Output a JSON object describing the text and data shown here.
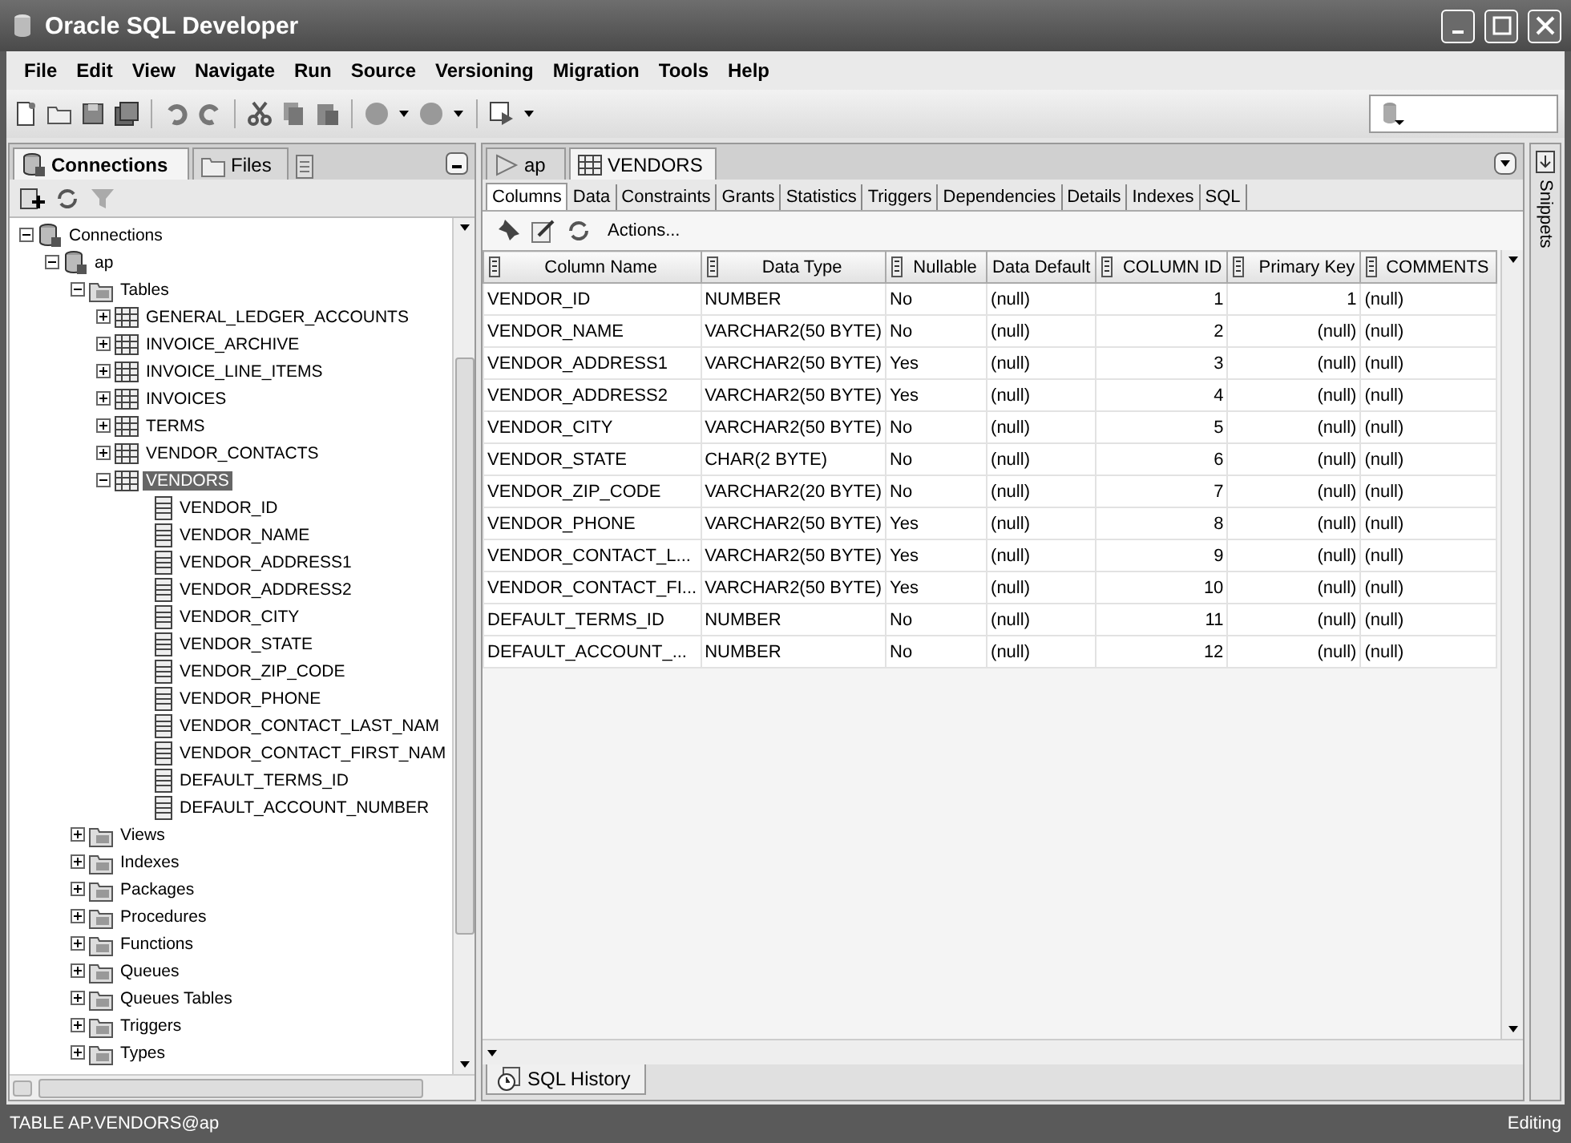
{
  "window": {
    "title": "Oracle SQL Developer"
  },
  "menu": [
    "File",
    "Edit",
    "View",
    "Navigate",
    "Run",
    "Source",
    "Versioning",
    "Migration",
    "Tools",
    "Help"
  ],
  "left_panel": {
    "tabs": [
      {
        "label": "Connections",
        "selected": true
      },
      {
        "label": "Files",
        "selected": false
      }
    ],
    "tree": [
      {
        "label": "Connections",
        "kind": "connections",
        "expanded": true,
        "selected": false,
        "children": [
          {
            "label": "ap",
            "kind": "connection",
            "expanded": true,
            "selected": false,
            "children": [
              {
                "label": "Tables",
                "kind": "folder",
                "expanded": true,
                "selected": false,
                "children": [
                  {
                    "label": "GENERAL_LEDGER_ACCOUNTS",
                    "kind": "table",
                    "expanded": false,
                    "selected": false
                  },
                  {
                    "label": "INVOICE_ARCHIVE",
                    "kind": "table",
                    "expanded": false,
                    "selected": false
                  },
                  {
                    "label": "INVOICE_LINE_ITEMS",
                    "kind": "table",
                    "expanded": false,
                    "selected": false
                  },
                  {
                    "label": "INVOICES",
                    "kind": "table",
                    "expanded": false,
                    "selected": false
                  },
                  {
                    "label": "TERMS",
                    "kind": "table",
                    "expanded": false,
                    "selected": false
                  },
                  {
                    "label": "VENDOR_CONTACTS",
                    "kind": "table",
                    "expanded": false,
                    "selected": false
                  },
                  {
                    "label": "VENDORS",
                    "kind": "table",
                    "expanded": true,
                    "selected": true,
                    "children": [
                      {
                        "label": "VENDOR_ID",
                        "kind": "column",
                        "selected": false
                      },
                      {
                        "label": "VENDOR_NAME",
                        "kind": "column",
                        "selected": false
                      },
                      {
                        "label": "VENDOR_ADDRESS1",
                        "kind": "column",
                        "selected": false
                      },
                      {
                        "label": "VENDOR_ADDRESS2",
                        "kind": "column",
                        "selected": false
                      },
                      {
                        "label": "VENDOR_CITY",
                        "kind": "column",
                        "selected": false
                      },
                      {
                        "label": "VENDOR_STATE",
                        "kind": "column",
                        "selected": false
                      },
                      {
                        "label": "VENDOR_ZIP_CODE",
                        "kind": "column",
                        "selected": false
                      },
                      {
                        "label": "VENDOR_PHONE",
                        "kind": "column",
                        "selected": false
                      },
                      {
                        "label": "VENDOR_CONTACT_LAST_NAM",
                        "kind": "column",
                        "selected": false
                      },
                      {
                        "label": "VENDOR_CONTACT_FIRST_NAM",
                        "kind": "column",
                        "selected": false
                      },
                      {
                        "label": "DEFAULT_TERMS_ID",
                        "kind": "column",
                        "selected": false
                      },
                      {
                        "label": "DEFAULT_ACCOUNT_NUMBER",
                        "kind": "column",
                        "selected": false
                      }
                    ]
                  }
                ]
              },
              {
                "label": "Views",
                "kind": "folder",
                "expanded": false,
                "selected": false
              },
              {
                "label": "Indexes",
                "kind": "folder",
                "expanded": false,
                "selected": false
              },
              {
                "label": "Packages",
                "kind": "folder",
                "expanded": false,
                "selected": false
              },
              {
                "label": "Procedures",
                "kind": "folder",
                "expanded": false,
                "selected": false
              },
              {
                "label": "Functions",
                "kind": "folder",
                "expanded": false,
                "selected": false
              },
              {
                "label": "Queues",
                "kind": "folder",
                "expanded": false,
                "selected": false
              },
              {
                "label": "Queues Tables",
                "kind": "folder",
                "expanded": false,
                "selected": false
              },
              {
                "label": "Triggers",
                "kind": "folder",
                "expanded": false,
                "selected": false
              },
              {
                "label": "Types",
                "kind": "folder",
                "expanded": false,
                "selected": false
              }
            ]
          }
        ]
      }
    ]
  },
  "editor": {
    "tabs": [
      {
        "label": "ap",
        "kind": "worksheet",
        "selected": false
      },
      {
        "label": "VENDORS",
        "kind": "table",
        "selected": true
      }
    ],
    "subtabs": [
      {
        "label": "Columns",
        "selected": true
      },
      {
        "label": "Data",
        "selected": false
      },
      {
        "label": "Constraints",
        "selected": false
      },
      {
        "label": "Grants",
        "selected": false
      },
      {
        "label": "Statistics",
        "selected": false
      },
      {
        "label": "Triggers",
        "selected": false
      },
      {
        "label": "Dependencies",
        "selected": false
      },
      {
        "label": "Details",
        "selected": false
      },
      {
        "label": "Indexes",
        "selected": false
      },
      {
        "label": "SQL",
        "selected": false
      }
    ],
    "actions_label": "Actions...",
    "table": {
      "columns": [
        {
          "label": "Column Name",
          "kind": "text",
          "sortable": true
        },
        {
          "label": "Data Type",
          "kind": "text",
          "sortable": true
        },
        {
          "label": "Nullable",
          "kind": "text",
          "sortable": true
        },
        {
          "label": "Data Default",
          "kind": "text",
          "sortable": false
        },
        {
          "label": "COLUMN ID",
          "kind": "number",
          "sortable": true
        },
        {
          "label": "Primary Key",
          "kind": "number",
          "sortable": true
        },
        {
          "label": "COMMENTS",
          "kind": "text",
          "sortable": true
        }
      ],
      "rows": [
        [
          "VENDOR_ID",
          "NUMBER",
          "No",
          "(null)",
          "1",
          "1",
          "(null)"
        ],
        [
          "VENDOR_NAME",
          "VARCHAR2(50 BYTE)",
          "No",
          "(null)",
          "2",
          "(null)",
          "(null)"
        ],
        [
          "VENDOR_ADDRESS1",
          "VARCHAR2(50 BYTE)",
          "Yes",
          "(null)",
          "3",
          "(null)",
          "(null)"
        ],
        [
          "VENDOR_ADDRESS2",
          "VARCHAR2(50 BYTE)",
          "Yes",
          "(null)",
          "4",
          "(null)",
          "(null)"
        ],
        [
          "VENDOR_CITY",
          "VARCHAR2(50 BYTE)",
          "No",
          "(null)",
          "5",
          "(null)",
          "(null)"
        ],
        [
          "VENDOR_STATE",
          "CHAR(2 BYTE)",
          "No",
          "(null)",
          "6",
          "(null)",
          "(null)"
        ],
        [
          "VENDOR_ZIP_CODE",
          "VARCHAR2(20 BYTE)",
          "No",
          "(null)",
          "7",
          "(null)",
          "(null)"
        ],
        [
          "VENDOR_PHONE",
          "VARCHAR2(50 BYTE)",
          "Yes",
          "(null)",
          "8",
          "(null)",
          "(null)"
        ],
        [
          "VENDOR_CONTACT_L...",
          "VARCHAR2(50 BYTE)",
          "Yes",
          "(null)",
          "9",
          "(null)",
          "(null)"
        ],
        [
          "VENDOR_CONTACT_FI...",
          "VARCHAR2(50 BYTE)",
          "Yes",
          "(null)",
          "10",
          "(null)",
          "(null)"
        ],
        [
          "DEFAULT_TERMS_ID",
          "NUMBER",
          "No",
          "(null)",
          "11",
          "(null)",
          "(null)"
        ],
        [
          "DEFAULT_ACCOUNT_...",
          "NUMBER",
          "No",
          "(null)",
          "12",
          "(null)",
          "(null)"
        ]
      ]
    },
    "bottom_tab": "SQL History"
  },
  "side_tab": "Snippets",
  "status_bar": {
    "left": "TABLE AP.VENDORS@ap",
    "right": "Editing"
  }
}
